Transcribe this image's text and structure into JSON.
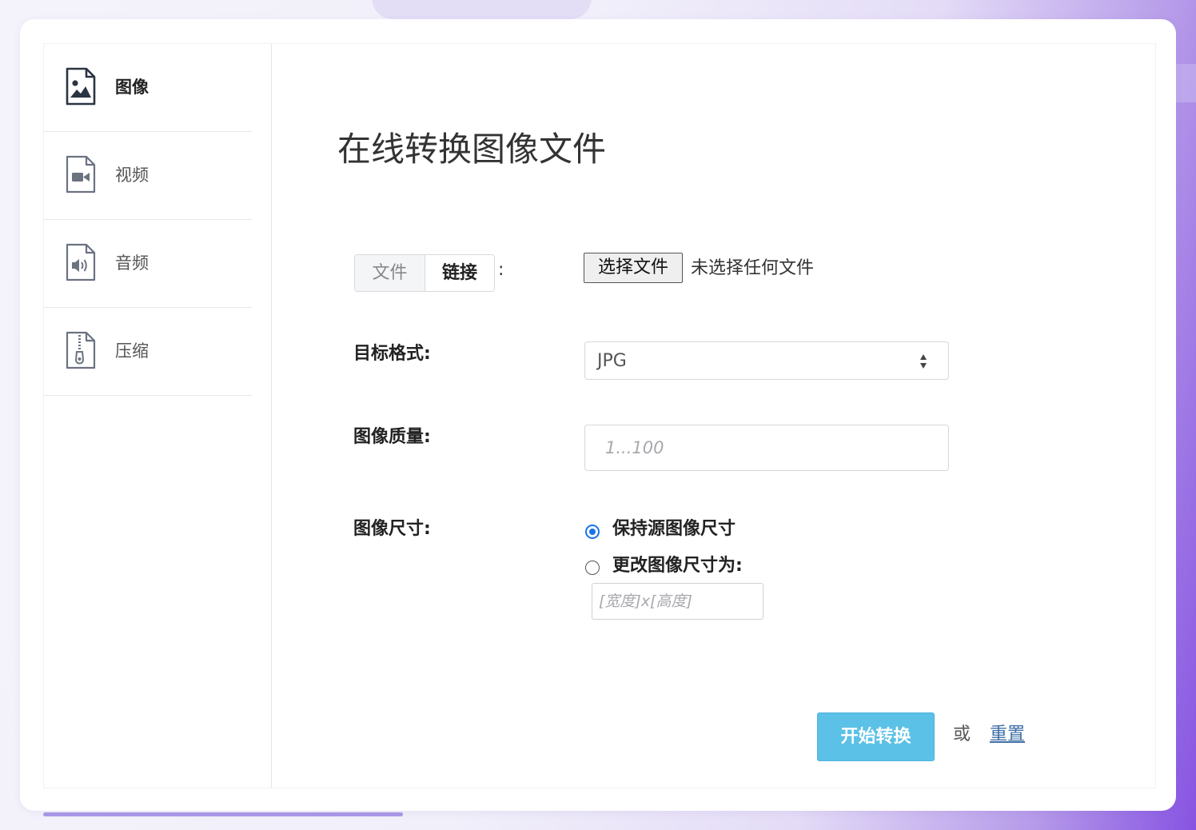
{
  "sidebar": {
    "items": [
      {
        "label": "图像",
        "icon": "image-file-icon",
        "active": true
      },
      {
        "label": "视频",
        "icon": "video-file-icon",
        "active": false
      },
      {
        "label": "音频",
        "icon": "audio-file-icon",
        "active": false
      },
      {
        "label": "压缩",
        "icon": "zip-file-icon",
        "active": false
      }
    ]
  },
  "main": {
    "title": "在线转换图像文件",
    "source": {
      "tabs": [
        "文件",
        "链接"
      ],
      "colon": ":",
      "choose_button": "选择文件",
      "file_status": "未选择任何文件"
    },
    "format": {
      "label": "目标格式:",
      "value": "JPG"
    },
    "quality": {
      "label": "图像质量:",
      "placeholder": "1...100"
    },
    "size": {
      "label": "图像尺寸:",
      "options": [
        {
          "label": "保持源图像尺寸",
          "checked": true
        },
        {
          "label": "更改图像尺寸为:",
          "checked": false
        }
      ],
      "placeholder": "[宽度]x[高度]"
    },
    "actions": {
      "convert": "开始转换",
      "or": "或",
      "reset": "重置"
    }
  },
  "colors": {
    "accent": "#5bc1e6",
    "radio": "#1a73e8",
    "link": "#3f6fa6"
  }
}
